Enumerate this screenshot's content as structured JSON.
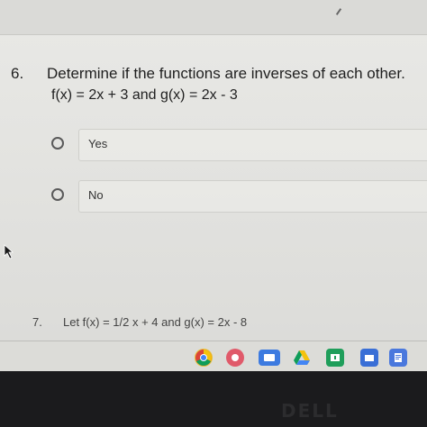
{
  "question6": {
    "number": "6.",
    "title": "Determine if the functions are inverses of each other.",
    "subtitle": "f(x) = 2x + 3  and  g(x) = 2x - 3",
    "options": [
      {
        "label": "Yes",
        "selected": false
      },
      {
        "label": "No",
        "selected": false
      }
    ]
  },
  "question7": {
    "number": "7.",
    "text": "Let f(x) = 1/2 x + 4  and  g(x) = 2x - 8"
  },
  "shelf": {
    "icons": [
      {
        "name": "chrome-icon",
        "color": "#e8c23a"
      },
      {
        "name": "app-icon",
        "color": "#e05a6a"
      },
      {
        "name": "meet-icon",
        "color": "#3d7be0"
      },
      {
        "name": "drive-icon",
        "color": "#f0b400"
      },
      {
        "name": "classroom-icon",
        "color": "#1f9e5a"
      },
      {
        "name": "files-icon",
        "color": "#3a6fd6"
      },
      {
        "name": "docs-icon",
        "color": "#4a78dd"
      }
    ]
  },
  "device": {
    "brand": "DELL"
  }
}
